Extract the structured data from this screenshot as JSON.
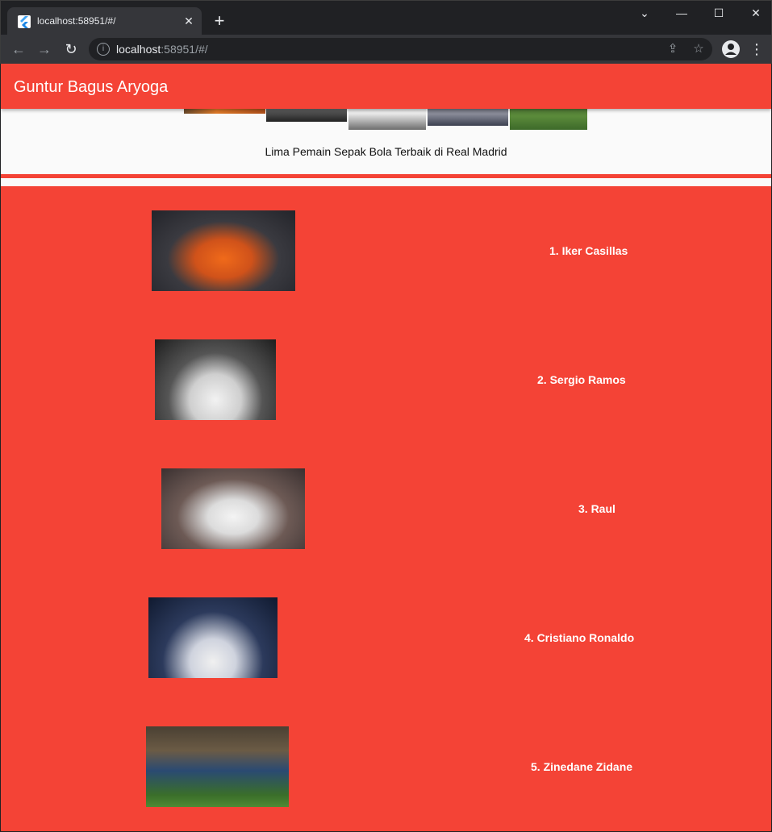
{
  "browser": {
    "tab_title": "localhost:58951/#/",
    "url_host": "localhost",
    "url_rest": ":58951/#/",
    "new_tab": "+",
    "close": "✕"
  },
  "app": {
    "title": "Guntur Bagus Aryoga",
    "banner_caption": "Lima Pemain Sepak Bola Terbaik di Real Madrid"
  },
  "players": [
    {
      "label": "1. Iker Casillas"
    },
    {
      "label": "2. Sergio Ramos"
    },
    {
      "label": "3. Raul"
    },
    {
      "label": "4. Cristiano Ronaldo"
    },
    {
      "label": "5. Zinedane Zidane"
    }
  ],
  "colors": {
    "primary": "#f44336",
    "chrome_dark": "#202124",
    "chrome_mid": "#35363a"
  }
}
